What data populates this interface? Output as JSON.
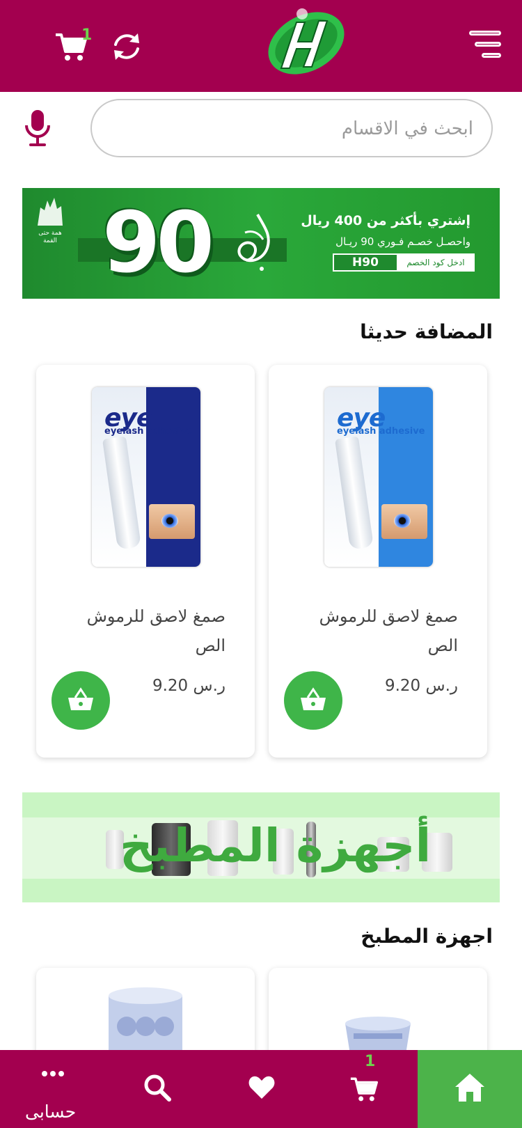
{
  "header": {
    "logo_text": "Hijaz",
    "cart_count": "1"
  },
  "search": {
    "placeholder": "ابحث في الاقسام"
  },
  "promo_banner": {
    "number": "90",
    "headline": "إشتري بأكثر من 400 ريال",
    "subline": "واحصـل خصـم فـوري 90 ريـال",
    "code_label": "ادخل كود الخصم",
    "code": "H90",
    "emblem_text": "همة حتى القمة"
  },
  "sections": {
    "new_arrivals_title": "المضافة حديثا",
    "kitchen_title": "اجهزة المطبخ"
  },
  "products": [
    {
      "name": "صمغ لاصق للرموش الص",
      "price": "ر.س 9.20",
      "brand": "eye",
      "brand_sub": "eyelash adhesive",
      "pkg_color": "#2f86e0",
      "brand_color": "#1d6bd0"
    },
    {
      "name": "صمغ لاصق للرموش الص",
      "price": "ر.س 9.20",
      "brand": "eye",
      "brand_sub": "eyelash adhesive",
      "pkg_color": "#1b2a8a",
      "brand_color": "#1b2a8a"
    }
  ],
  "kitchen_banner": {
    "title": "أجهزة المطبخ"
  },
  "bottom_nav": {
    "account_label": "حسابى",
    "cart_count": "1"
  },
  "colors": {
    "brand": "#a3004f",
    "accent_green": "#4cb34a"
  }
}
